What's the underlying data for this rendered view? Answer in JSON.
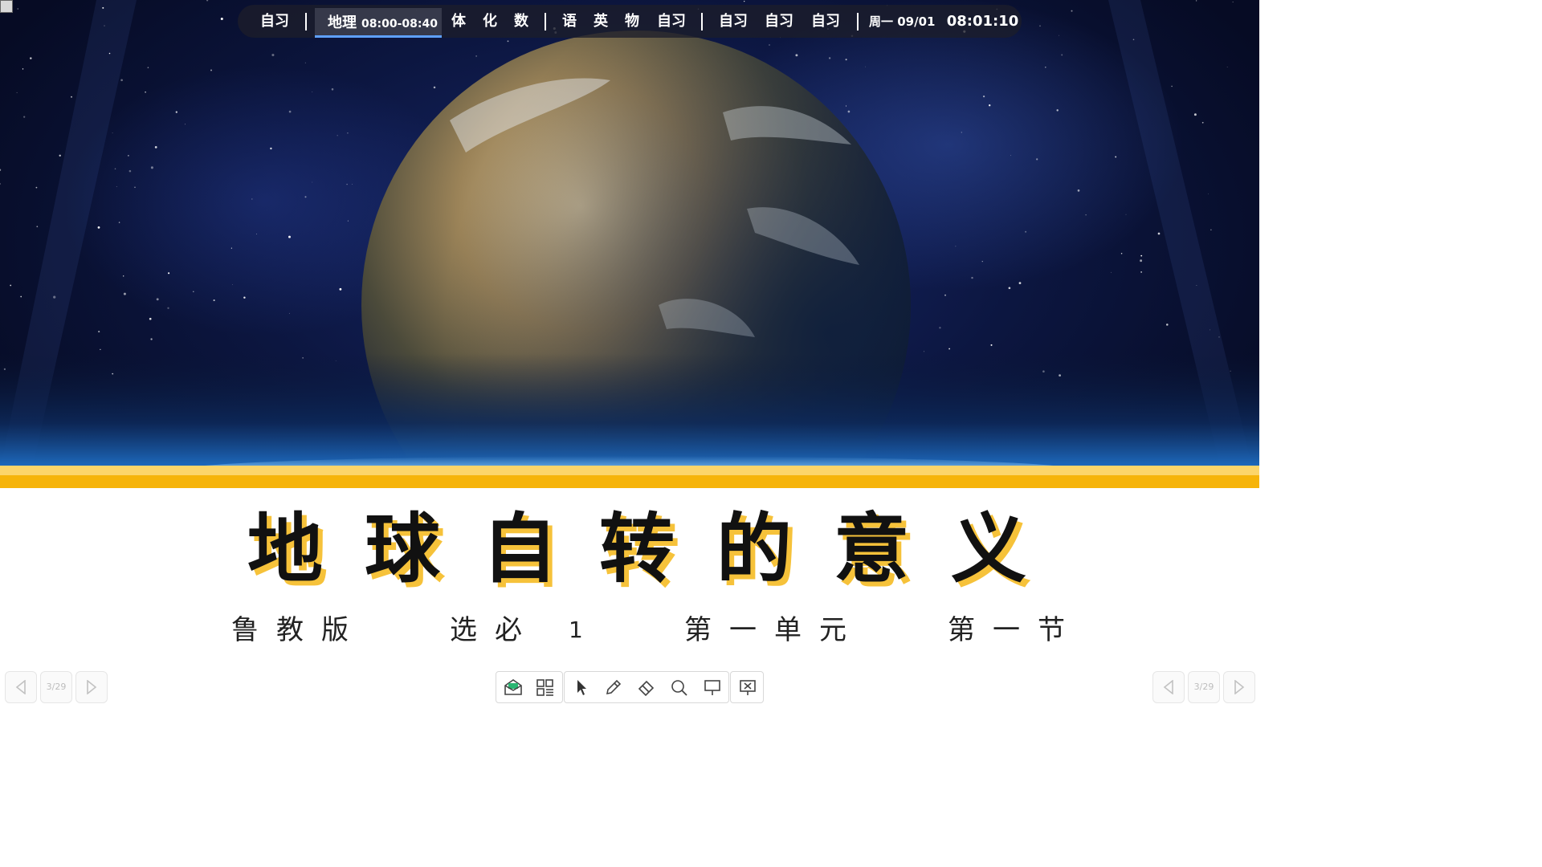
{
  "schedule": {
    "items_before": [
      "自习"
    ],
    "current": {
      "name": "地理",
      "time": "08:00-08:40"
    },
    "group_a": [
      "体",
      "化",
      "数"
    ],
    "group_b": [
      "语",
      "英",
      "物",
      "自习"
    ],
    "group_c": [
      "自习",
      "自习",
      "自习"
    ],
    "date": "周一 09/01",
    "clock": "08:01:10"
  },
  "slide": {
    "title_chars": [
      "地",
      "球",
      "自",
      "转",
      "的",
      "意",
      "义"
    ],
    "subtitle": {
      "publisher": "鲁教版",
      "book": "选必",
      "book_number": "1",
      "unit": "第一单元",
      "section": "第一节"
    }
  },
  "pager_left": {
    "count": "3/29"
  },
  "pager_right": {
    "count": "3/29"
  },
  "toolbar": {
    "tools": [
      "envelope-icon",
      "grid-icon",
      "pointer-icon",
      "pen-icon",
      "eraser-icon",
      "magnifier-icon",
      "whiteboard-icon",
      "exit-show-icon"
    ]
  },
  "colors": {
    "accent_yellow": "#f6b40a",
    "title_shadow": "#f6c23a",
    "active_underline": "#5ea0ff"
  }
}
